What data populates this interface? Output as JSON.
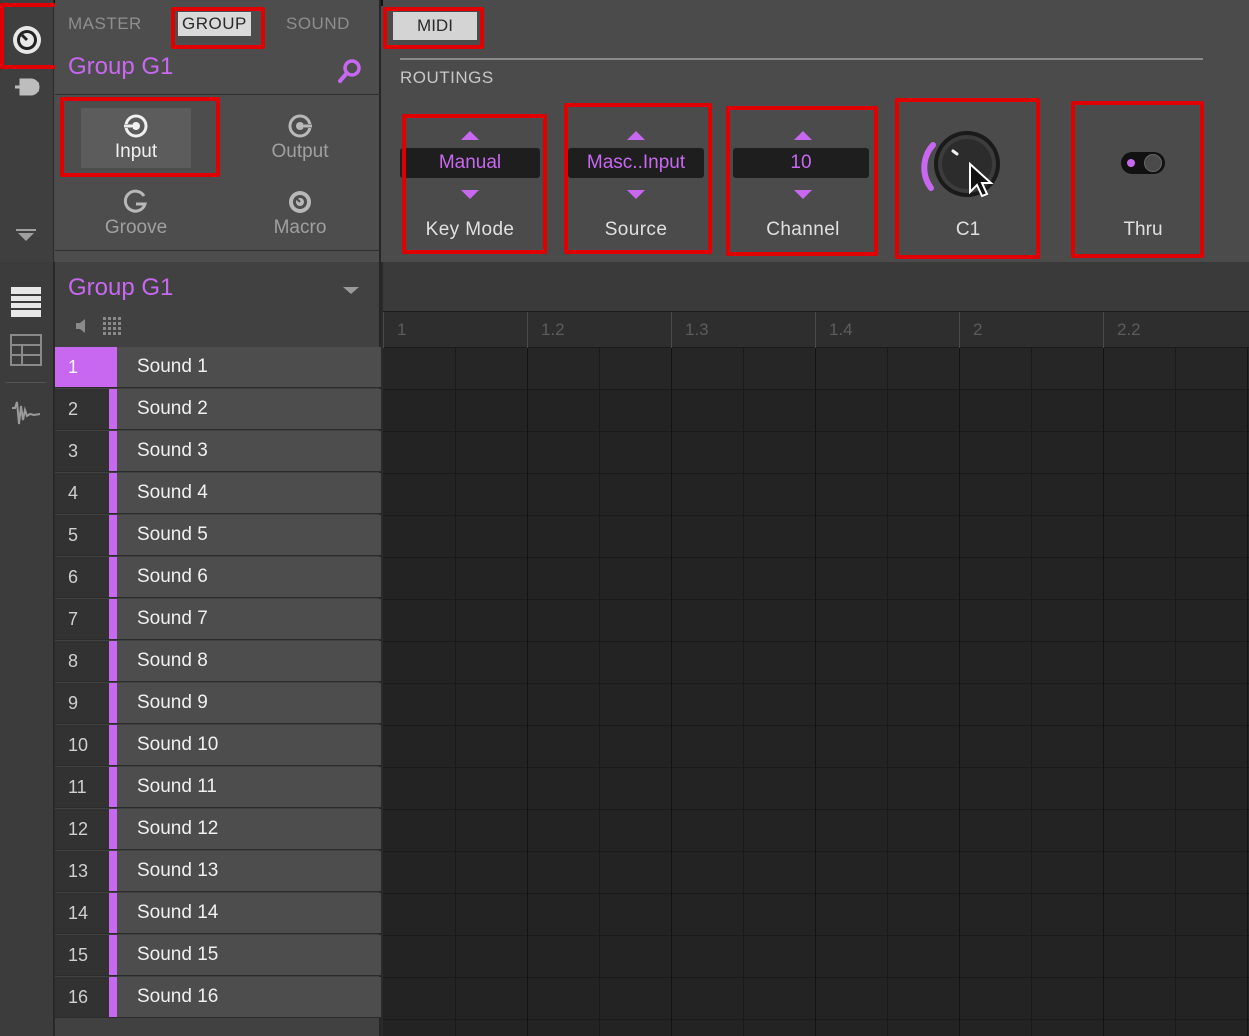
{
  "header": {
    "tabs": [
      "MASTER",
      "GROUP",
      "SOUND"
    ],
    "active_tab": "GROUP",
    "group_name": "Group G1",
    "pages": [
      {
        "label": "Input",
        "icon": "input-icon",
        "active": true
      },
      {
        "label": "Output",
        "icon": "output-icon",
        "active": false
      },
      {
        "label": "Groove",
        "icon": "groove-icon",
        "active": false
      },
      {
        "label": "Macro",
        "icon": "macro-icon",
        "active": false
      }
    ]
  },
  "routing": {
    "tab_label": "MIDI",
    "section_title": "ROUTINGS",
    "params": [
      {
        "label": "Key Mode",
        "value": "Manual"
      },
      {
        "label": "Source",
        "value": "Masc..Input"
      },
      {
        "label": "Channel",
        "value": "10"
      }
    ],
    "knob": {
      "label": "C1"
    },
    "toggle": {
      "label": "Thru",
      "on": true
    }
  },
  "sound_list": {
    "group_title": "Group G1",
    "sounds": [
      {
        "num": "1",
        "name": "Sound 1"
      },
      {
        "num": "2",
        "name": "Sound 2"
      },
      {
        "num": "3",
        "name": "Sound 3"
      },
      {
        "num": "4",
        "name": "Sound 4"
      },
      {
        "num": "5",
        "name": "Sound 5"
      },
      {
        "num": "6",
        "name": "Sound 6"
      },
      {
        "num": "7",
        "name": "Sound 7"
      },
      {
        "num": "8",
        "name": "Sound 8"
      },
      {
        "num": "9",
        "name": "Sound 9"
      },
      {
        "num": "10",
        "name": "Sound 10"
      },
      {
        "num": "11",
        "name": "Sound 11"
      },
      {
        "num": "12",
        "name": "Sound 12"
      },
      {
        "num": "13",
        "name": "Sound 13"
      },
      {
        "num": "14",
        "name": "Sound 14"
      },
      {
        "num": "15",
        "name": "Sound 15"
      },
      {
        "num": "16",
        "name": "Sound 16"
      }
    ],
    "selected_index": 0
  },
  "ruler": {
    "labels": [
      "1",
      "1.2",
      "1.3",
      "1.4",
      "2",
      "2.2"
    ]
  },
  "colors": {
    "accent": "#c868f0",
    "highlight": "#e00000"
  }
}
